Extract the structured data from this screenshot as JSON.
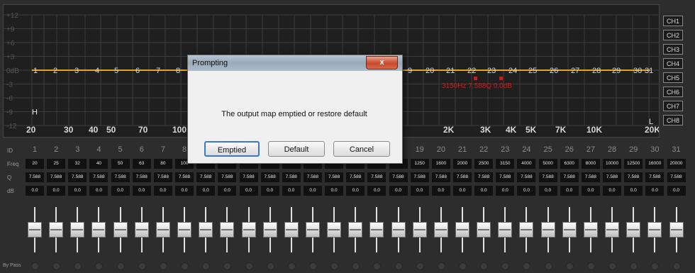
{
  "graph": {
    "y_labels": [
      "+12",
      "+9",
      "+6",
      "+3",
      "0dB",
      "-3",
      "-6",
      "-9",
      "-12"
    ],
    "x_labels": [
      "20",
      "30",
      "40",
      "50",
      "70",
      "100",
      "2K",
      "3K",
      "4K",
      "5K",
      "7K",
      "10K",
      "20K"
    ],
    "band_numbers": [
      "1",
      "2",
      "3",
      "4",
      "5",
      "6",
      "7",
      "8",
      "9",
      "20",
      "21",
      "22",
      "23",
      "24",
      "25",
      "26",
      "27",
      "28",
      "29",
      "30",
      "31"
    ],
    "selected_band_label": "3150Hz 7.588Q 0.0dB",
    "high_marker": "H",
    "low_marker": "L",
    "colors": {
      "curve": "#e8a21c",
      "grid": "#3c3c3c",
      "text": "#8a8a8a",
      "selected": "#d41818"
    }
  },
  "channels": [
    "CH1",
    "CH2",
    "CH3",
    "CH4",
    "CH5",
    "CH6",
    "CH7",
    "CH8"
  ],
  "table": {
    "row_labels": {
      "id": "ID",
      "freq": "Freq",
      "q": "Q",
      "db": "dB"
    },
    "ids": [
      "1",
      "2",
      "3",
      "4",
      "5",
      "6",
      "7",
      "8",
      "",
      "",
      "",
      "",
      "",
      "",
      "",
      "",
      "",
      "",
      "19",
      "20",
      "21",
      "22",
      "23",
      "24",
      "25",
      "26",
      "27",
      "28",
      "29",
      "30",
      "31"
    ],
    "freqs": [
      "20",
      "25",
      "32",
      "40",
      "50",
      "63",
      "80",
      "100",
      "",
      "",
      "",
      "",
      "",
      "",
      "",
      "",
      "",
      "",
      "1250",
      "1600",
      "2000",
      "2500",
      "3150",
      "4000",
      "5000",
      "6300",
      "8000",
      "10000",
      "12500",
      "16000",
      "20000"
    ],
    "q": [
      "7.588",
      "7.588",
      "7.588",
      "7.588",
      "7.588",
      "7.588",
      "7.588",
      "7.588",
      "7.588",
      "7.588",
      "7.588",
      "7.588",
      "7.588",
      "7.588",
      "7.588",
      "7.588",
      "7.588",
      "7.588",
      "7.588",
      "7.588",
      "7.588",
      "7.588",
      "7.588",
      "7.588",
      "7.588",
      "7.588",
      "7.588",
      "7.588",
      "7.588",
      "7.588",
      "7.588"
    ],
    "db": [
      "0.0",
      "0.0",
      "0.0",
      "0.0",
      "0.0",
      "0.0",
      "0.0",
      "0.0",
      "0.0",
      "0.0",
      "0.0",
      "0.0",
      "0.0",
      "0.0",
      "0.0",
      "0.0",
      "0.0",
      "0.0",
      "0.0",
      "0.0",
      "0.0",
      "0.0",
      "0.0",
      "0.0",
      "0.0",
      "0.0",
      "0.0",
      "0.0",
      "0.0",
      "0.0",
      "0.0"
    ]
  },
  "bypass_label": "By Pass",
  "dialog": {
    "title": "Prompting",
    "close": "x",
    "message": "The output map emptied or restore default",
    "buttons": {
      "emptied": "Emptied",
      "default": "Default",
      "cancel": "Cancel"
    }
  }
}
